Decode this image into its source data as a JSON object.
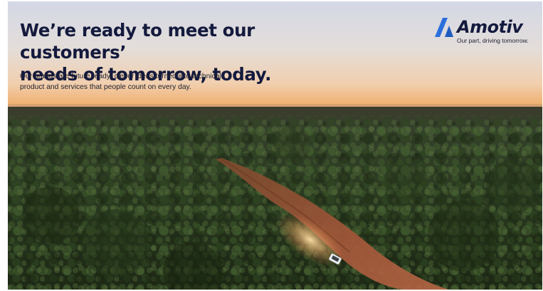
{
  "hero": {
    "headline_line1": "We’re ready to meet our customers’",
    "headline_line2": "needs of tomorrow, today.",
    "subtext_line1": "Our brands are future ready; clever ideas turned into technical",
    "subtext_line2": "product and services that people count on every day."
  },
  "brand": {
    "name": "Amotiv",
    "tagline": "Our part, driving tomorrow.",
    "logo_icon": "amotiv-logo-mark",
    "accent_color": "#2b6fdc",
    "text_color": "#141a3d"
  },
  "photo": {
    "subject": "aerial-forest-road-with-vehicle",
    "sky_colors": [
      "#d2d8e6",
      "#e6dfd8",
      "#f3cfa8",
      "#f0b06c"
    ],
    "forest_color": "#243019",
    "road_color": "#9c5233"
  }
}
